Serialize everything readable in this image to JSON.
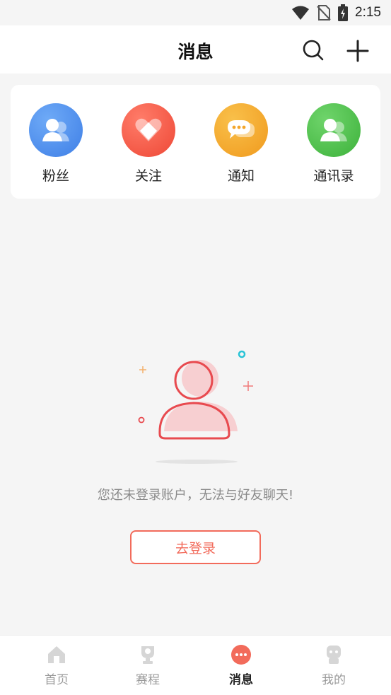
{
  "status_bar": {
    "time": "2:15",
    "icons": [
      "wifi-icon",
      "no-sim-icon",
      "battery-icon"
    ]
  },
  "header": {
    "title": "消息",
    "icons": [
      "search-icon",
      "add-icon"
    ]
  },
  "quick_actions": [
    {
      "label": "粉丝",
      "icon": "fans-icon",
      "color": "#4a8ff0"
    },
    {
      "label": "关注",
      "icon": "heart-icon",
      "color": "#f25a48"
    },
    {
      "label": "通知",
      "icon": "chat-bubble-icon",
      "color": "#f4a62a"
    },
    {
      "label": "通讯录",
      "icon": "contacts-icon",
      "color": "#4fc24f"
    }
  ],
  "empty_state": {
    "message": "您还未登录账户，无法与好友聊天!",
    "button_label": "去登录",
    "accent_color": "#f26b5b"
  },
  "tabs": [
    {
      "label": "首页",
      "icon": "home-icon",
      "active": false
    },
    {
      "label": "赛程",
      "icon": "trophy-icon",
      "active": false
    },
    {
      "label": "消息",
      "icon": "message-icon",
      "active": true
    },
    {
      "label": "我的",
      "icon": "profile-icon",
      "active": false
    }
  ]
}
